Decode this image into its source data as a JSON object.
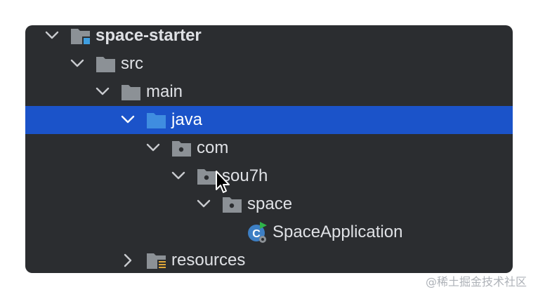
{
  "tree": {
    "items": [
      {
        "label": "space-starter",
        "expanded": true,
        "icon": "module-folder-icon"
      },
      {
        "label": "src",
        "expanded": true,
        "icon": "folder-icon"
      },
      {
        "label": "main",
        "expanded": true,
        "icon": "folder-icon"
      },
      {
        "label": "java",
        "expanded": true,
        "icon": "source-root-folder-icon",
        "selected": true
      },
      {
        "label": "com",
        "expanded": true,
        "icon": "package-icon"
      },
      {
        "label": "sou7h",
        "expanded": true,
        "icon": "package-icon"
      },
      {
        "label": "space",
        "expanded": true,
        "icon": "package-icon"
      },
      {
        "label": "SpaceApplication",
        "icon": "spring-boot-class-icon"
      },
      {
        "label": "resources",
        "expanded": false,
        "icon": "resources-folder-icon"
      }
    ]
  },
  "watermark": "@稀土掘金技术社区",
  "colors": {
    "panel_bg": "#2b2d30",
    "selection": "#1b53c9",
    "text": "#dfe1e5",
    "folder": "#8c9196",
    "source_folder": "#3f8de0"
  }
}
